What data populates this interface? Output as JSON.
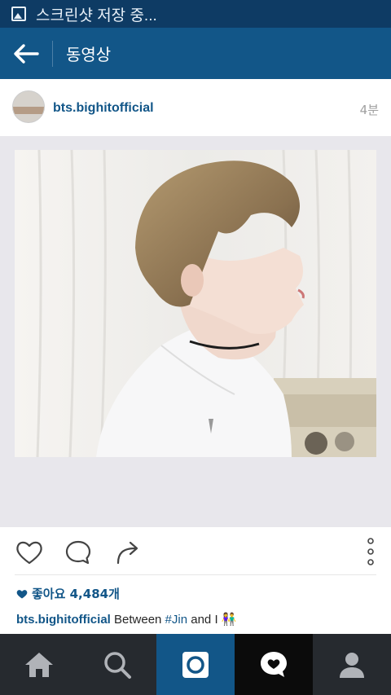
{
  "status_bar": {
    "text": "스크린샷 저장 중...",
    "icon": "image-icon"
  },
  "app_bar": {
    "title": "동영상",
    "back_icon": "back-arrow-icon"
  },
  "post": {
    "username": "bts.bighitofficial",
    "time": "4분",
    "likes_text": "좋아요 4,484개",
    "caption": {
      "username": "bts.bighitofficial",
      "text_before": "Between ",
      "hashtag": "#Jin",
      "text_after": " and I ",
      "emoji": "👫"
    }
  },
  "tabs": [
    {
      "name": "home",
      "icon": "home-icon"
    },
    {
      "name": "search",
      "icon": "search-icon"
    },
    {
      "name": "camera",
      "icon": "camera-icon",
      "active": true
    },
    {
      "name": "news",
      "icon": "heart-bubble-icon"
    },
    {
      "name": "profile",
      "icon": "profile-icon"
    }
  ],
  "colors": {
    "brand": "#125688",
    "status_bar": "#0e3b64",
    "tabbar": "#262a2f"
  }
}
